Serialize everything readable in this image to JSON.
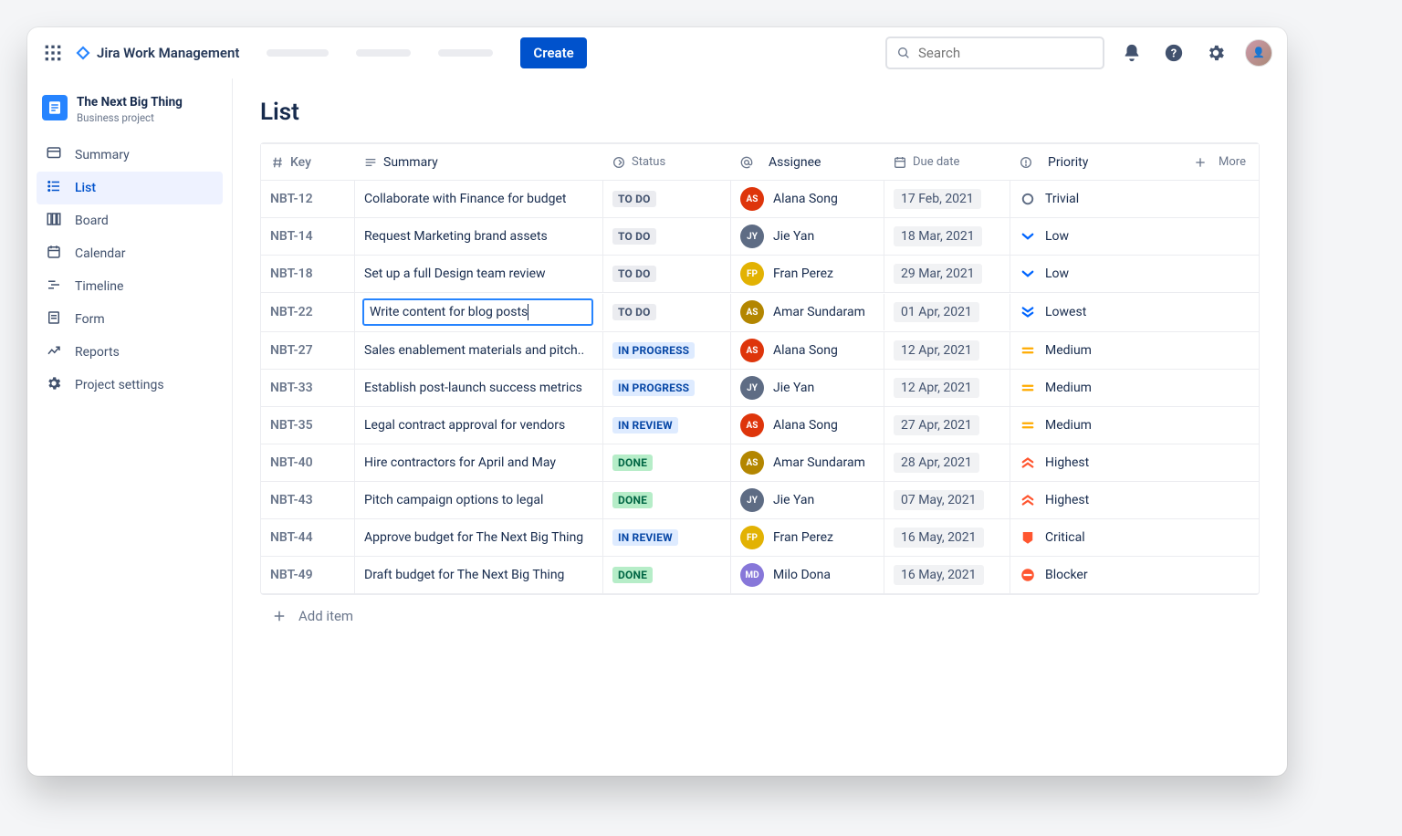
{
  "brand": "Jira Work Management",
  "create_label": "Create",
  "search_placeholder": "Search",
  "project": {
    "name": "The Next Big Thing",
    "type": "Business project"
  },
  "sidebar": [
    {
      "id": "summary",
      "label": "Summary"
    },
    {
      "id": "list",
      "label": "List",
      "active": true
    },
    {
      "id": "board",
      "label": "Board"
    },
    {
      "id": "calendar",
      "label": "Calendar"
    },
    {
      "id": "timeline",
      "label": "Timeline"
    },
    {
      "id": "form",
      "label": "Form"
    },
    {
      "id": "reports",
      "label": "Reports"
    },
    {
      "id": "settings",
      "label": "Project settings"
    }
  ],
  "page_title": "List",
  "columns": {
    "key": "Key",
    "summary": "Summary",
    "status": "Status",
    "assignee": "Assignee",
    "due": "Due date",
    "priority": "Priority",
    "more": "More"
  },
  "add_item_label": "Add item",
  "rows": [
    {
      "key": "NBT-12",
      "summary": "Collaborate with Finance for budget",
      "status": "TO DO",
      "status_class": "st-todo",
      "assignee": "Alana Song",
      "av": "#de350b",
      "due": "17 Feb, 2021",
      "priority": "Trivial",
      "pri": "trivial"
    },
    {
      "key": "NBT-14",
      "summary": "Request Marketing brand assets",
      "status": "TO DO",
      "status_class": "st-todo",
      "assignee": "Jie Yan",
      "av": "#5e6c84",
      "due": "18 Mar, 2021",
      "priority": "Low",
      "pri": "low"
    },
    {
      "key": "NBT-18",
      "summary": "Set up a full Design team review",
      "status": "TO DO",
      "status_class": "st-todo",
      "assignee": "Fran Perez",
      "av": "#e2b203",
      "due": "29 Mar, 2021",
      "priority": "Low",
      "pri": "low"
    },
    {
      "key": "NBT-22",
      "summary": "Write content for blog posts",
      "status": "TO DO",
      "status_class": "st-todo",
      "assignee": "Amar Sundaram",
      "av": "#b38600",
      "due": "01 Apr, 2021",
      "priority": "Lowest",
      "pri": "lowest",
      "editing": true
    },
    {
      "key": "NBT-27",
      "summary": "Sales enablement materials and pitch..",
      "status": "IN PROGRESS",
      "status_class": "st-inprogress",
      "assignee": "Alana Song",
      "av": "#de350b",
      "due": "12 Apr, 2021",
      "priority": "Medium",
      "pri": "medium"
    },
    {
      "key": "NBT-33",
      "summary": "Establish post-launch success metrics",
      "status": "IN PROGRESS",
      "status_class": "st-inprogress",
      "assignee": "Jie Yan",
      "av": "#5e6c84",
      "due": "12 Apr, 2021",
      "priority": "Medium",
      "pri": "medium"
    },
    {
      "key": "NBT-35",
      "summary": "Legal contract approval for vendors",
      "status": "IN REVIEW",
      "status_class": "st-inreview",
      "assignee": "Alana Song",
      "av": "#de350b",
      "due": "27 Apr, 2021",
      "priority": "Medium",
      "pri": "medium"
    },
    {
      "key": "NBT-40",
      "summary": "Hire contractors for April and May",
      "status": "DONE",
      "status_class": "st-done",
      "assignee": "Amar Sundaram",
      "av": "#b38600",
      "due": "28 Apr, 2021",
      "priority": "Highest",
      "pri": "highest"
    },
    {
      "key": "NBT-43",
      "summary": "Pitch campaign options to legal",
      "status": "DONE",
      "status_class": "st-done",
      "assignee": "Jie Yan",
      "av": "#5e6c84",
      "due": "07 May, 2021",
      "priority": "Highest",
      "pri": "highest"
    },
    {
      "key": "NBT-44",
      "summary": "Approve budget for The Next Big Thing",
      "status": "IN REVIEW",
      "status_class": "st-inreview",
      "assignee": "Fran Perez",
      "av": "#e2b203",
      "due": "16 May, 2021",
      "priority": "Critical",
      "pri": "critical"
    },
    {
      "key": "NBT-49",
      "summary": "Draft budget for The Next Big Thing",
      "status": "DONE",
      "status_class": "st-done",
      "assignee": "Milo Dona",
      "av": "#8777d9",
      "due": "16 May, 2021",
      "priority": "Blocker",
      "pri": "blocker"
    }
  ]
}
